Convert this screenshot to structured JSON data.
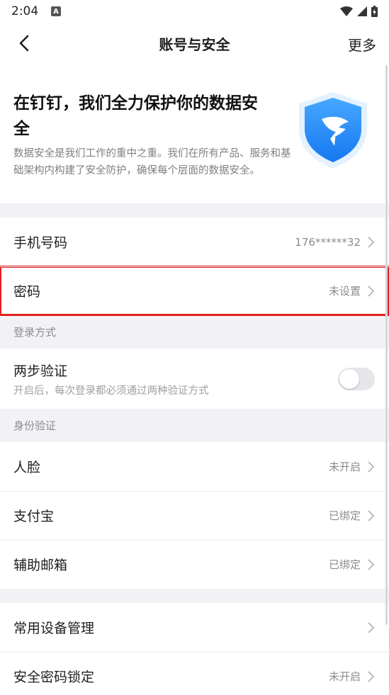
{
  "status_bar": {
    "time": "2:04",
    "notif_badge": "A"
  },
  "nav": {
    "title": "账号与安全",
    "more": "更多"
  },
  "intro": {
    "heading": "在钉钉，我们全力保护你的数据安全",
    "description": "数据安全是我们工作的重中之重。我们在所有产品、服务和基础架构内构建了安全防护，确保每个层面的数据安全。"
  },
  "account_rows": [
    {
      "label": "手机号码",
      "value": "176******32"
    },
    {
      "label": "密码",
      "value": "未设置"
    }
  ],
  "login_section": {
    "header": "登录方式",
    "two_step": {
      "label": "两步验证",
      "sub": "开启后，每次登录都必须通过两种验证方式",
      "enabled": false
    }
  },
  "identity_section": {
    "header": "身份验证",
    "rows": [
      {
        "label": "人脸",
        "value": "未开启"
      },
      {
        "label": "支付宝",
        "value": "已绑定"
      },
      {
        "label": "辅助邮箱",
        "value": "已绑定"
      }
    ]
  },
  "device_rows": [
    {
      "label": "常用设备管理",
      "value": ""
    },
    {
      "label": "安全密码锁定",
      "value": "未开启"
    }
  ],
  "colors": {
    "accent_blue": "#1a8cff",
    "highlight_red": "#e02020",
    "background": "#f2f2f6"
  }
}
